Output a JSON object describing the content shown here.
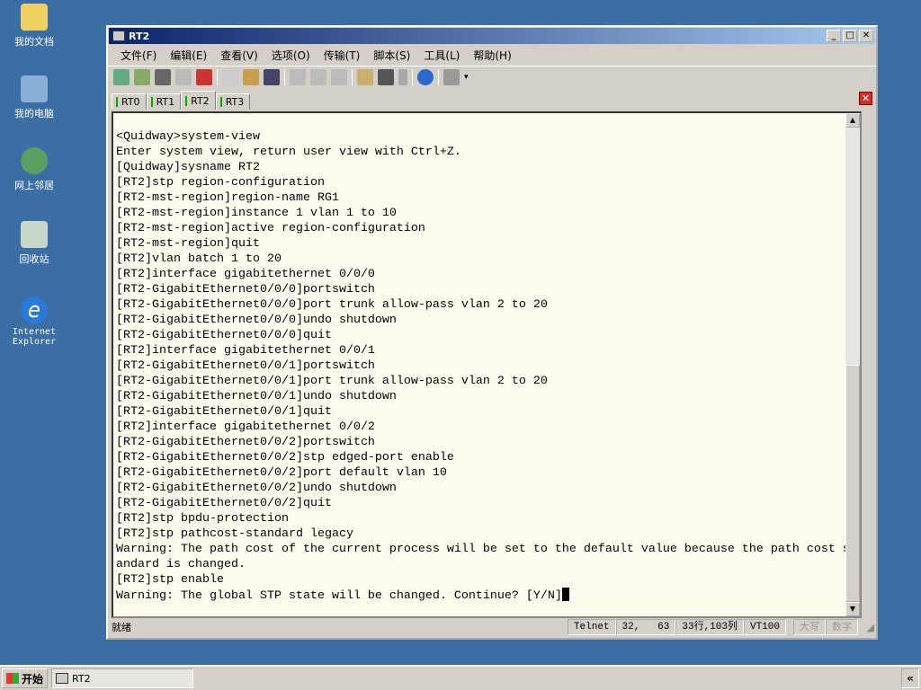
{
  "desktop": {
    "icons": [
      {
        "label": "我的文档"
      },
      {
        "label": "我的电脑"
      },
      {
        "label": "网上邻居"
      },
      {
        "label": "回收站"
      },
      {
        "label": "Internet Explorer"
      }
    ]
  },
  "window": {
    "title": "RT2",
    "menu": [
      "文件(F)",
      "编辑(E)",
      "查看(V)",
      "选项(O)",
      "传输(T)",
      "脚本(S)",
      "工具(L)",
      "帮助(H)"
    ],
    "tabs": [
      "RT0",
      "RT1",
      "RT2",
      "RT3"
    ],
    "active_tab": "RT2",
    "terminal": "<Quidway>system-view\nEnter system view, return user view with Ctrl+Z.\n[Quidway]sysname RT2\n[RT2]stp region-configuration\n[RT2-mst-region]region-name RG1\n[RT2-mst-region]instance 1 vlan 1 to 10\n[RT2-mst-region]active region-configuration\n[RT2-mst-region]quit\n[RT2]vlan batch 1 to 20\n[RT2]interface gigabitethernet 0/0/0\n[RT2-GigabitEthernet0/0/0]portswitch\n[RT2-GigabitEthernet0/0/0]port trunk allow-pass vlan 2 to 20\n[RT2-GigabitEthernet0/0/0]undo shutdown\n[RT2-GigabitEthernet0/0/0]quit\n[RT2]interface gigabitethernet 0/0/1\n[RT2-GigabitEthernet0/0/1]portswitch\n[RT2-GigabitEthernet0/0/1]port trunk allow-pass vlan 2 to 20\n[RT2-GigabitEthernet0/0/1]undo shutdown\n[RT2-GigabitEthernet0/0/1]quit\n[RT2]interface gigabitethernet 0/0/2\n[RT2-GigabitEthernet0/0/2]portswitch\n[RT2-GigabitEthernet0/0/2]stp edged-port enable\n[RT2-GigabitEthernet0/0/2]port default vlan 10\n[RT2-GigabitEthernet0/0/2]undo shutdown\n[RT2-GigabitEthernet0/0/2]quit\n[RT2]stp bpdu-protection\n[RT2]stp pathcost-standard legacy\nWarning: The path cost of the current process will be set to the default value because the path cost st\nandard is changed.\n[RT2]stp enable\nWarning: The global STP state will be changed. Continue? [Y/N]",
    "status": {
      "ready": "就绪",
      "protocol": "Telnet",
      "pos_row": "32,",
      "pos_col": "63",
      "size": "33行,103列",
      "emulation": "VT100",
      "caps": "大写",
      "num": "数字"
    }
  },
  "taskbar": {
    "start": "开始",
    "task": "RT2",
    "tray_btn": "«"
  }
}
